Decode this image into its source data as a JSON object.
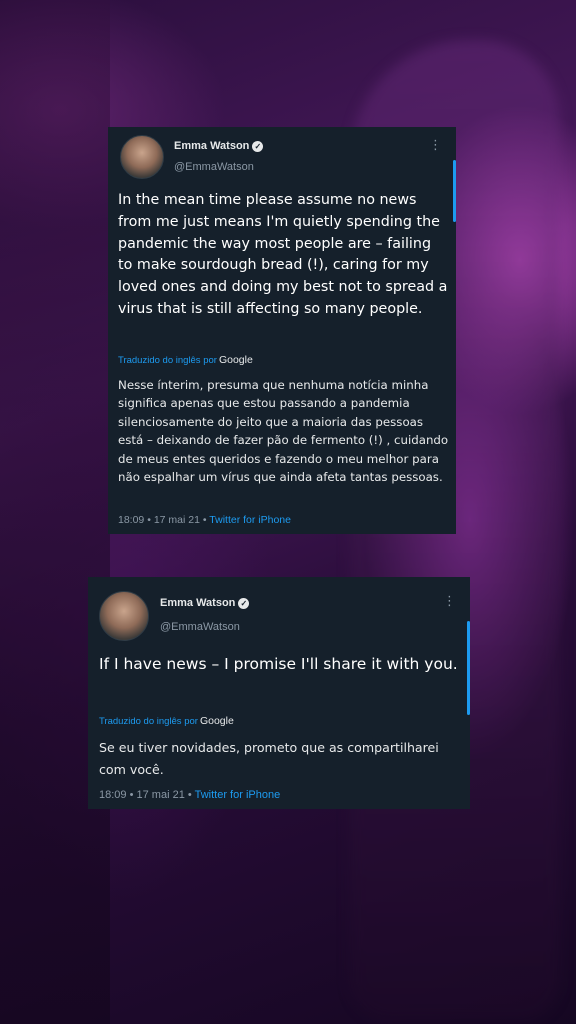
{
  "tweets": [
    {
      "author_name": "Emma Watson",
      "handle": "@EmmaWatson",
      "verified_glyph": "✓",
      "more_glyph": "⋮",
      "text": "In the mean time please assume no news from me just means I'm quietly spending the pandemic the way most people are – failing to make sourdough bread (!), caring for my loved ones and doing my best not to spread a virus that is still affecting so many people.",
      "translated_label": "Traduzido do inglês por",
      "translator": "Google",
      "translation": "Nesse ínterim, presuma que nenhuma notícia minha significa apenas que estou passando a pandemia silenciosamente do jeito que a maioria das pessoas está – deixando de fazer pão de fermento (!) , cuidando de meus entes queridos e fazendo o meu melhor para não espalhar um vírus que ainda afeta tantas pessoas.",
      "time": "18:09",
      "date": "17 mai 21",
      "source": "Twitter for iPhone",
      "sep": "•"
    },
    {
      "author_name": "Emma Watson",
      "handle": "@EmmaWatson",
      "verified_glyph": "✓",
      "more_glyph": "⋮",
      "text": "If I have news – I promise I'll share it with you.",
      "translated_label": "Traduzido do inglês por",
      "translator": "Google",
      "translation": "Se eu tiver novidades, prometo que as compartilharei com você.",
      "time": "18:09",
      "date": "17 mai 21",
      "source": "Twitter for iPhone",
      "sep": "•"
    }
  ],
  "icons": {
    "verified": "verified-badge-icon",
    "more": "more-options-icon"
  },
  "colors": {
    "card_bg": "#15202b",
    "accent": "#1d9bf0",
    "muted": "#8b98a5"
  }
}
